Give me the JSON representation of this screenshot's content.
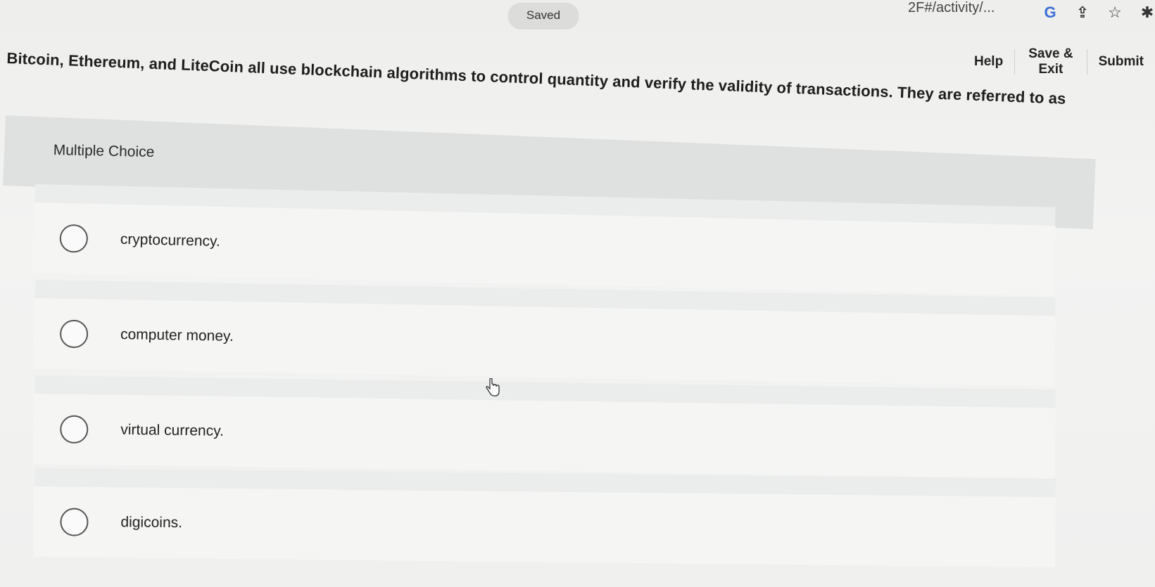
{
  "browser": {
    "url_fragment": "2F#/activity/...",
    "icons": [
      "google-icon",
      "share-icon",
      "star-icon",
      "extension-icon"
    ],
    "icon_glyphs": [
      "G",
      "⇪",
      "☆",
      "✱"
    ]
  },
  "status": {
    "saved_label": "Saved"
  },
  "nav": {
    "help_label": "Help",
    "save_exit_label": "Save & Exit",
    "submit_label": "Submit"
  },
  "question": {
    "text": "Bitcoin, Ethereum, and LiteCoin all use blockchain algorithms to control quantity and verify the validity of transactions. They are referred to as",
    "type_label": "Multiple Choice"
  },
  "choices": [
    {
      "label": "cryptocurrency."
    },
    {
      "label": "computer money."
    },
    {
      "label": "virtual currency."
    },
    {
      "label": "digicoins."
    }
  ],
  "colors": {
    "background": "#f1f1f0",
    "panel": "#dfe1e1",
    "choice_bg": "#f5f5f4"
  }
}
